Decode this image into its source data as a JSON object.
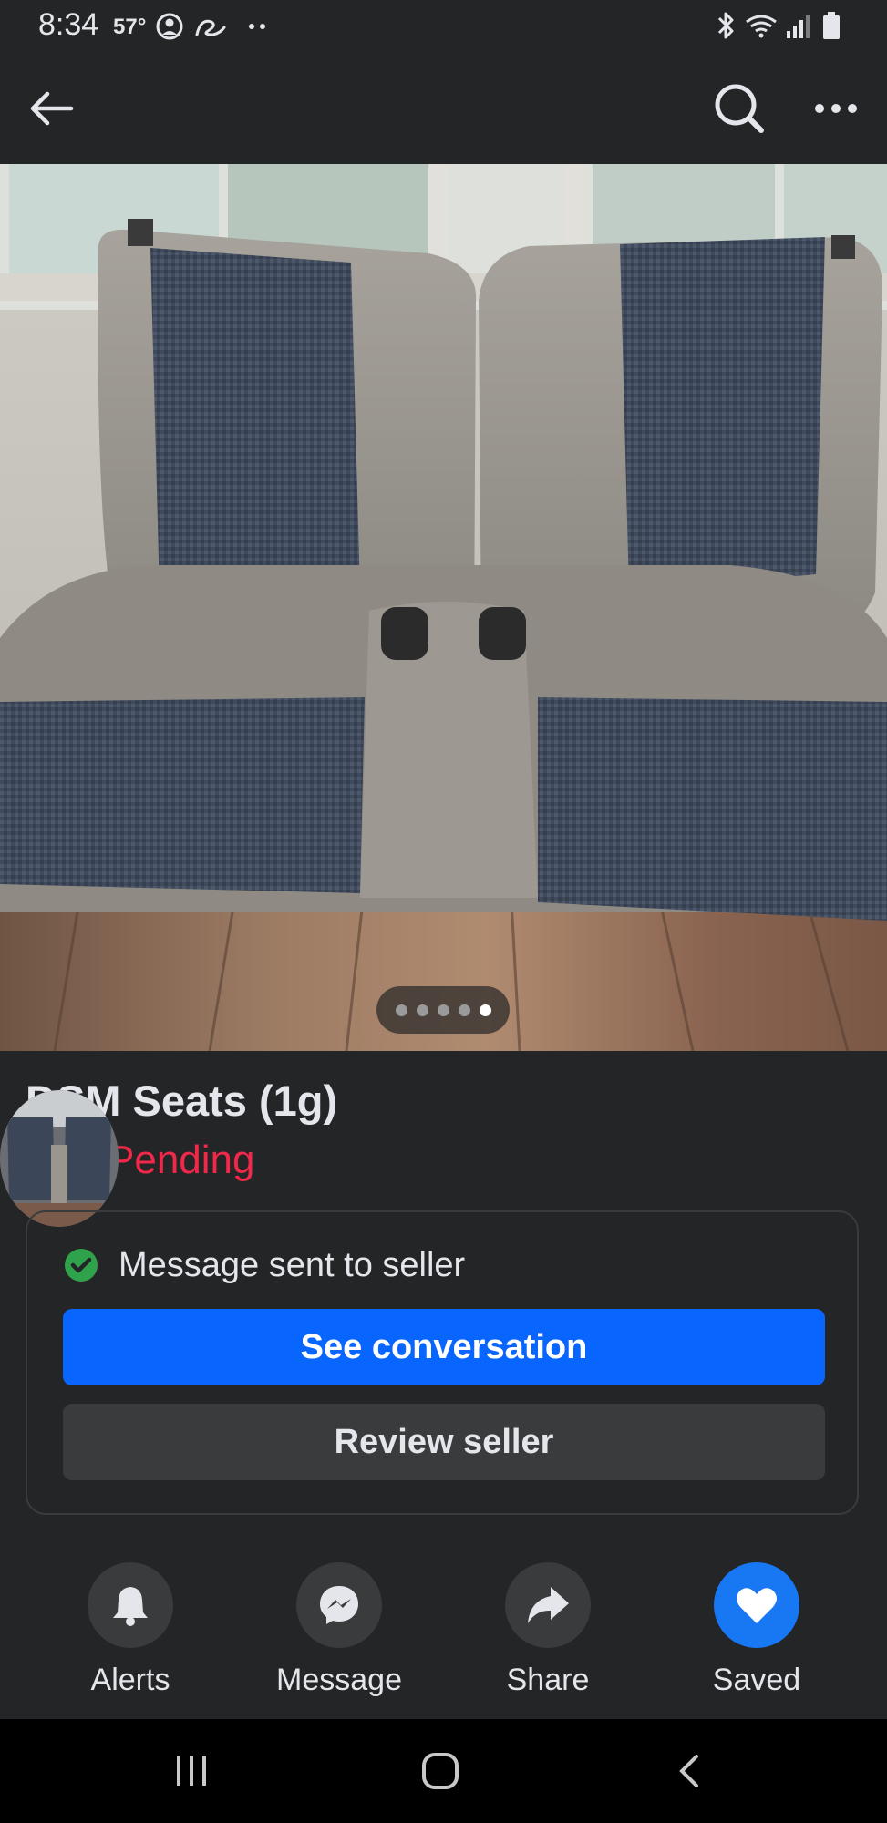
{
  "status_bar": {
    "time": "8:34",
    "temperature": "57°",
    "icons": [
      "profile-icon",
      "app-icon",
      "dots-icon",
      "bluetooth-icon",
      "wifi-icon",
      "signal-icon",
      "battery-icon"
    ]
  },
  "nav": {
    "icons": [
      "back-arrow-icon",
      "search-icon",
      "more-icon"
    ]
  },
  "photo": {
    "subject": "rear seats photo",
    "page_count": 5,
    "active_page": 5
  },
  "listing": {
    "title": "DSM Seats (1g)",
    "status": "Pending"
  },
  "message_card": {
    "message": "Message sent to seller",
    "primary_button": "See conversation",
    "secondary_button": "Review seller"
  },
  "actions": [
    {
      "label": "Alerts",
      "icon": "bell-icon",
      "active": false
    },
    {
      "label": "Message",
      "icon": "messenger-icon",
      "active": false
    },
    {
      "label": "Share",
      "icon": "share-icon",
      "active": false
    },
    {
      "label": "Saved",
      "icon": "heart-icon",
      "active": true
    }
  ],
  "colors": {
    "background": "#242526",
    "accent": "#0866ff",
    "status_pending": "#f02849",
    "check": "#31a24c",
    "saved": "#1877f2"
  }
}
